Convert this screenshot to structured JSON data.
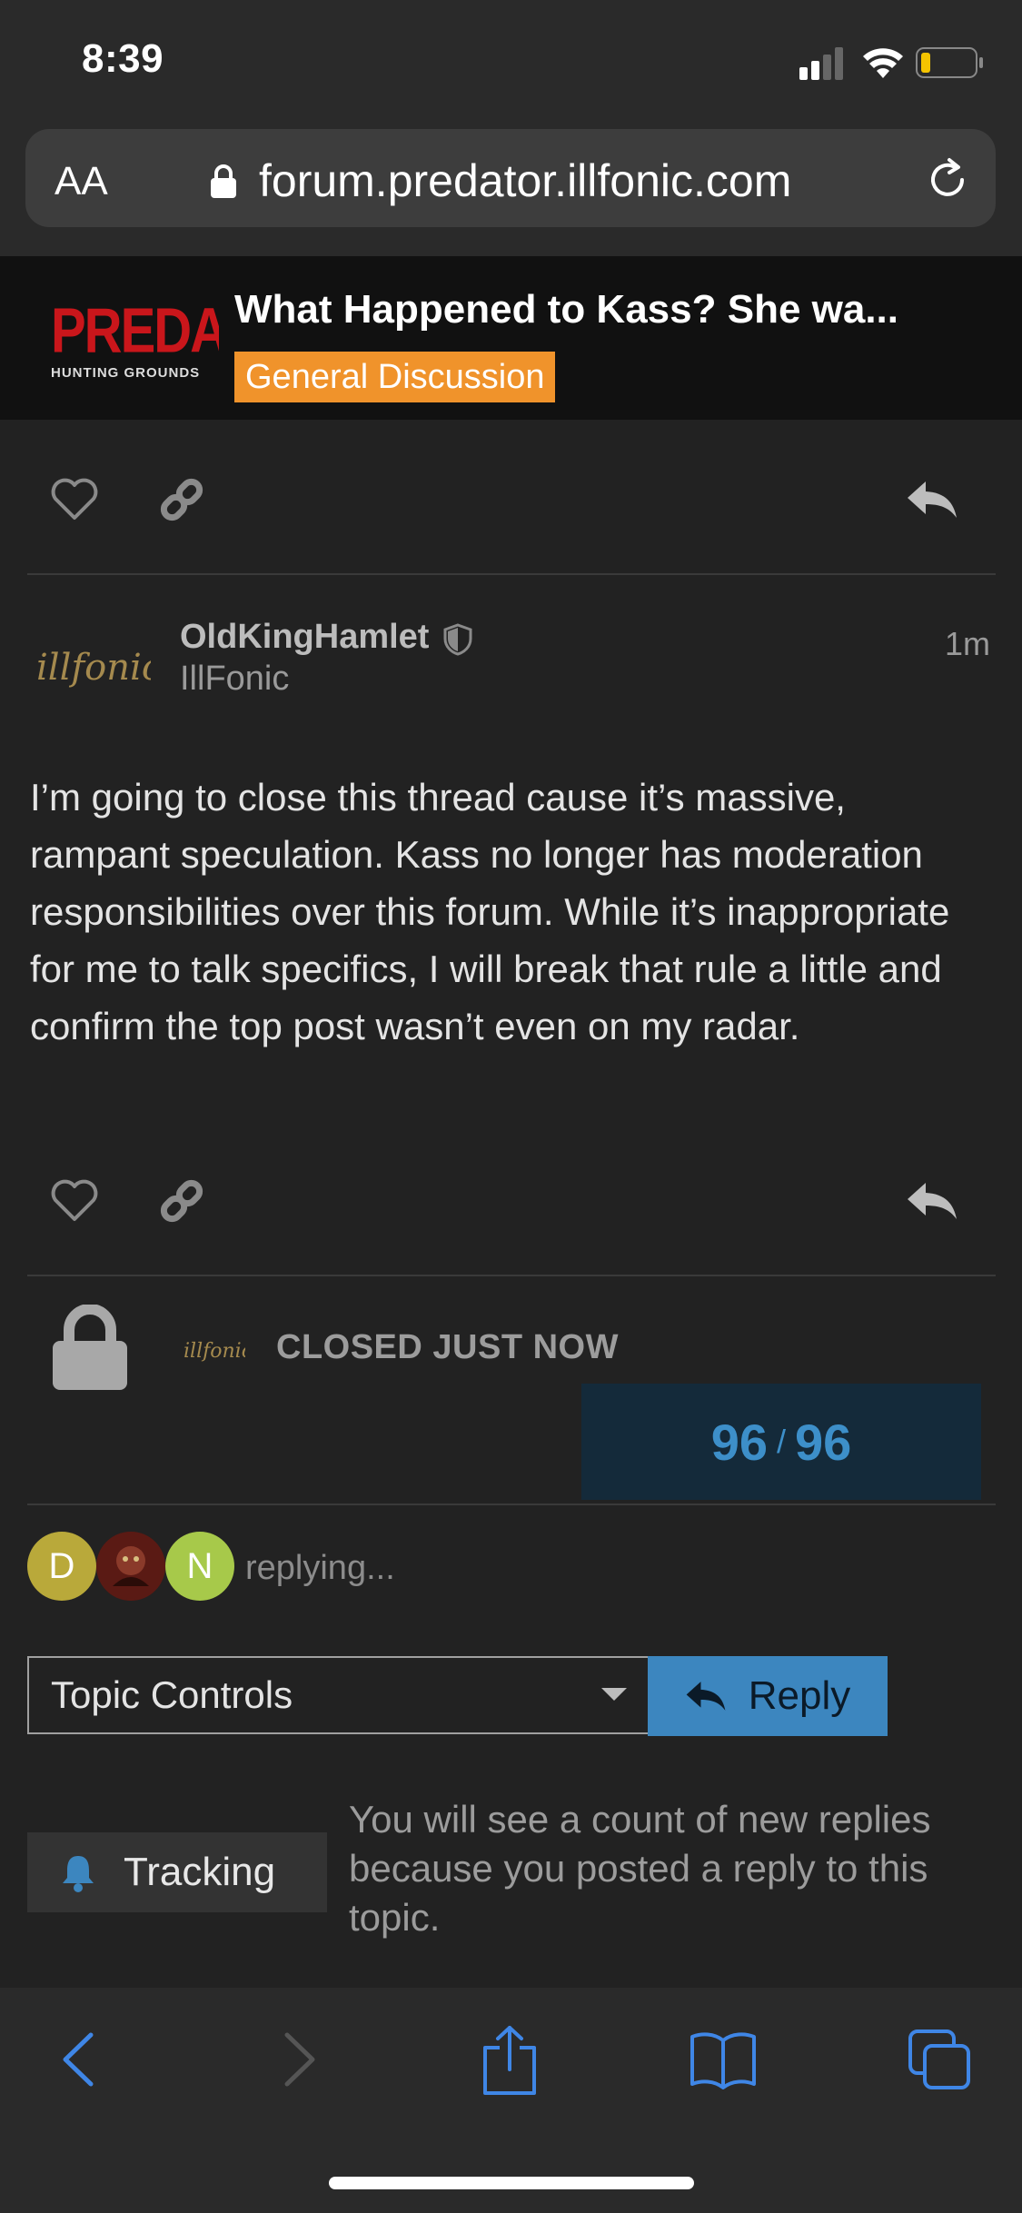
{
  "status_bar": {
    "time": "8:39"
  },
  "browser": {
    "text_size_label": "AA",
    "url": "forum.predator.illfonic.com"
  },
  "header": {
    "logo_text": "PREDATOR",
    "logo_subtext": "HUNTING GROUNDS",
    "topic_title": "What Happened to Kass? She wa...",
    "category": "General Discussion",
    "category_color": "#f0932b"
  },
  "post": {
    "username": "OldKingHamlet",
    "user_title": "IllFonic",
    "time": "1m",
    "avatar_text": "illfonic",
    "body": "I’m going to close this thread cause it’s massive, rampant speculation. Kass no longer has moderation responsibilities over this forum. While it’s inappropriate for me to talk specifics, I will break that rule a little and confirm the top post wasn’t even on my radar."
  },
  "closed_notice": {
    "text": "CLOSED JUST NOW",
    "avatar_text": "illfonic"
  },
  "progress": {
    "current": "96",
    "separator": "/",
    "total": "96"
  },
  "replying": {
    "avatars": [
      {
        "letter": "D",
        "color": "#b9a93a"
      },
      {
        "letter": "",
        "color": "#5a1a14"
      },
      {
        "letter": "N",
        "color": "#a7c94a"
      }
    ],
    "text": "replying..."
  },
  "controls": {
    "topic_controls_label": "Topic Controls",
    "reply_label": "Reply",
    "tracking_label": "Tracking",
    "tracking_description": "You will see a count of new replies because you posted a reply to this topic."
  },
  "colors": {
    "accent": "#3c86bf",
    "background": "#222222"
  }
}
